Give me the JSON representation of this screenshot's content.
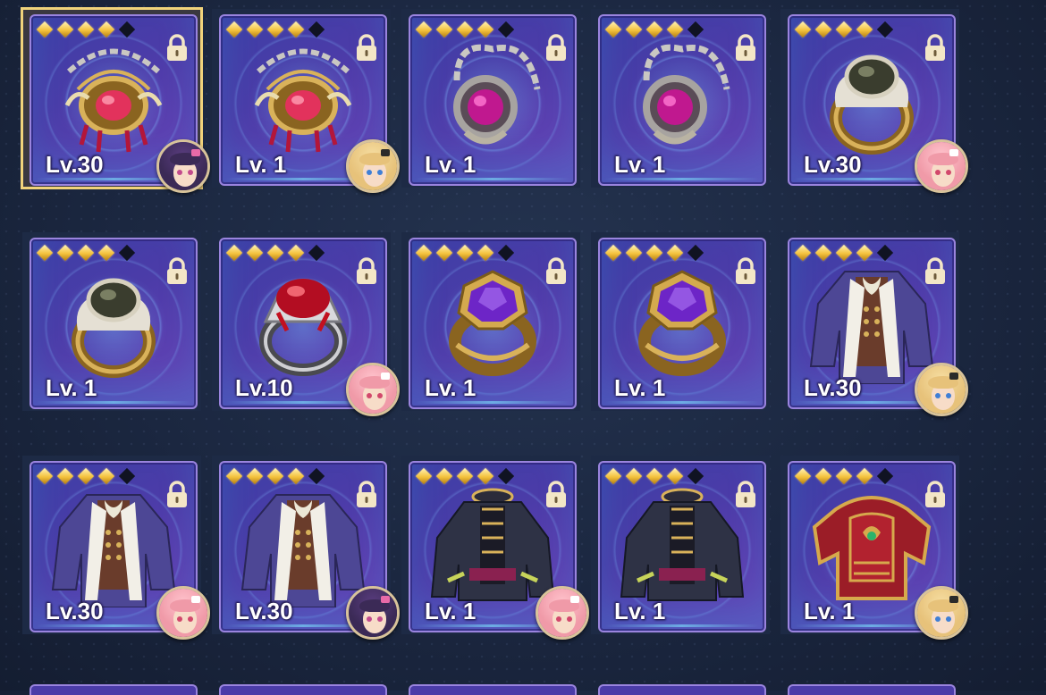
{
  "inventory": {
    "rows": [
      [
        {
          "level": "Lv.30",
          "stars": 4,
          "item": "jewel-necklace-red-icon",
          "selected": true,
          "avatar": "dark-hair-girl"
        },
        {
          "level": "Lv. 1",
          "stars": 4,
          "item": "jewel-necklace-red-icon",
          "selected": false,
          "avatar": "blonde-girl"
        },
        {
          "level": "Lv. 1",
          "stars": 4,
          "item": "chain-amulet-magenta-icon",
          "selected": false,
          "avatar": null
        },
        {
          "level": "Lv. 1",
          "stars": 4,
          "item": "chain-amulet-magenta-icon",
          "selected": false,
          "avatar": null
        },
        {
          "level": "Lv.30",
          "stars": 4,
          "item": "ring-black-stone-icon",
          "selected": false,
          "avatar": "pink-hair-girl"
        }
      ],
      [
        {
          "level": "Lv. 1",
          "stars": 4,
          "item": "ring-black-stone-icon",
          "selected": false,
          "avatar": null
        },
        {
          "level": "Lv.10",
          "stars": 4,
          "item": "ring-red-gem-icon",
          "selected": false,
          "avatar": "pink-hair-girl"
        },
        {
          "level": "Lv. 1",
          "stars": 4,
          "item": "ring-purple-gem-icon",
          "selected": false,
          "avatar": null
        },
        {
          "level": "Lv. 1",
          "stars": 4,
          "item": "ring-purple-gem-icon",
          "selected": false,
          "avatar": null
        },
        {
          "level": "Lv.30",
          "stars": 4,
          "item": "coat-purple-icon",
          "selected": false,
          "avatar": "blonde-girl"
        }
      ],
      [
        {
          "level": "Lv.30",
          "stars": 4,
          "item": "coat-purple-icon",
          "selected": false,
          "avatar": "pink-hair-girl"
        },
        {
          "level": "Lv.30",
          "stars": 4,
          "item": "coat-purple-icon",
          "selected": false,
          "avatar": "dark-hair-girl"
        },
        {
          "level": "Lv. 1",
          "stars": 4,
          "item": "coat-black-gold-icon",
          "selected": false,
          "avatar": "pink-hair-girl"
        },
        {
          "level": "Lv. 1",
          "stars": 4,
          "item": "coat-black-gold-icon",
          "selected": false,
          "avatar": null
        },
        {
          "level": "Lv. 1",
          "stars": 4,
          "item": "armor-red-icon",
          "selected": false,
          "avatar": "blonde-girl"
        }
      ]
    ],
    "max_stars": 5,
    "colors": {
      "star": "#f4c23d",
      "selection": "#f1d37b",
      "card_border": "#9a84de"
    }
  }
}
